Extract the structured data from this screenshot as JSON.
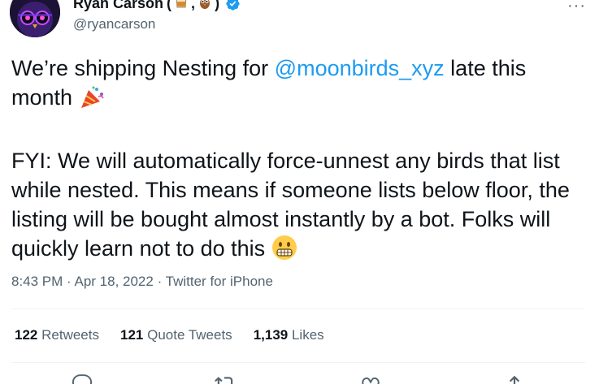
{
  "author": {
    "name": "Ryan Carson",
    "name_suffix_open": "(",
    "name_suffix_sep": ",",
    "name_suffix_close": ")",
    "handle": "@ryancarson"
  },
  "more_label": "···",
  "tweet": {
    "line1_prefix": "We’re shipping Nesting for ",
    "mention": "@moonbirds_xyz",
    "line1_suffix": " late this month",
    "para2": "FYI: We will automatically force-unnest any birds that list while nested. This means if someone lists below floor, the listing will be bought almost instantly by a bot. Folks will quickly learn not to do this"
  },
  "meta": {
    "time": "8:43 PM",
    "sep1": " · ",
    "date": "Apr 18, 2022",
    "sep2": " · ",
    "source": "Twitter for iPhone"
  },
  "stats": {
    "retweets_count": "122",
    "retweets_label": "Retweets",
    "quotes_count": "121",
    "quotes_label": "Quote Tweets",
    "likes_count": "1,139",
    "likes_label": "Likes"
  },
  "colors": {
    "accent": "#1d9bf0",
    "secondary_text": "#536471",
    "primary_text": "#0f1419"
  },
  "icons": [
    "verified-badge-icon",
    "party-popper-icon",
    "grimacing-face-icon",
    "reply-icon",
    "retweet-icon",
    "like-icon",
    "share-icon"
  ]
}
